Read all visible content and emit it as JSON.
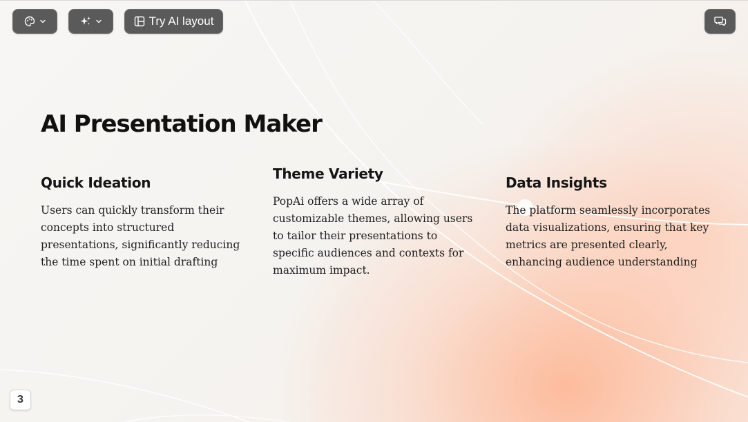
{
  "toolbar": {
    "palette_icon": "palette-icon",
    "sparkle_icon": "sparkle-icon",
    "layout_icon": "layout-icon",
    "layout_label": "Try AI layout",
    "comment_icon": "chat-bubbles-icon"
  },
  "slide": {
    "title": "AI Presentation Maker",
    "columns": [
      {
        "heading": "Quick Ideation",
        "body": "Users can quickly transform their concepts into structured presentations, significantly reducing the time spent on initial drafting"
      },
      {
        "heading": "Theme Variety",
        "body": "PopAi offers a wide array of customizable themes, allowing users to tailor their presentations to specific audiences and contexts for maximum impact."
      },
      {
        "heading": "Data Insights",
        "body": "The platform seamlessly incorporates data visualizations, ensuring that key metrics are presented clearly, enhancing audience understanding"
      }
    ]
  },
  "page_number": "3",
  "colors": {
    "toolbar_button": "#5a5a5a",
    "accent_glow": "#ffaa82",
    "text": "#111111"
  }
}
